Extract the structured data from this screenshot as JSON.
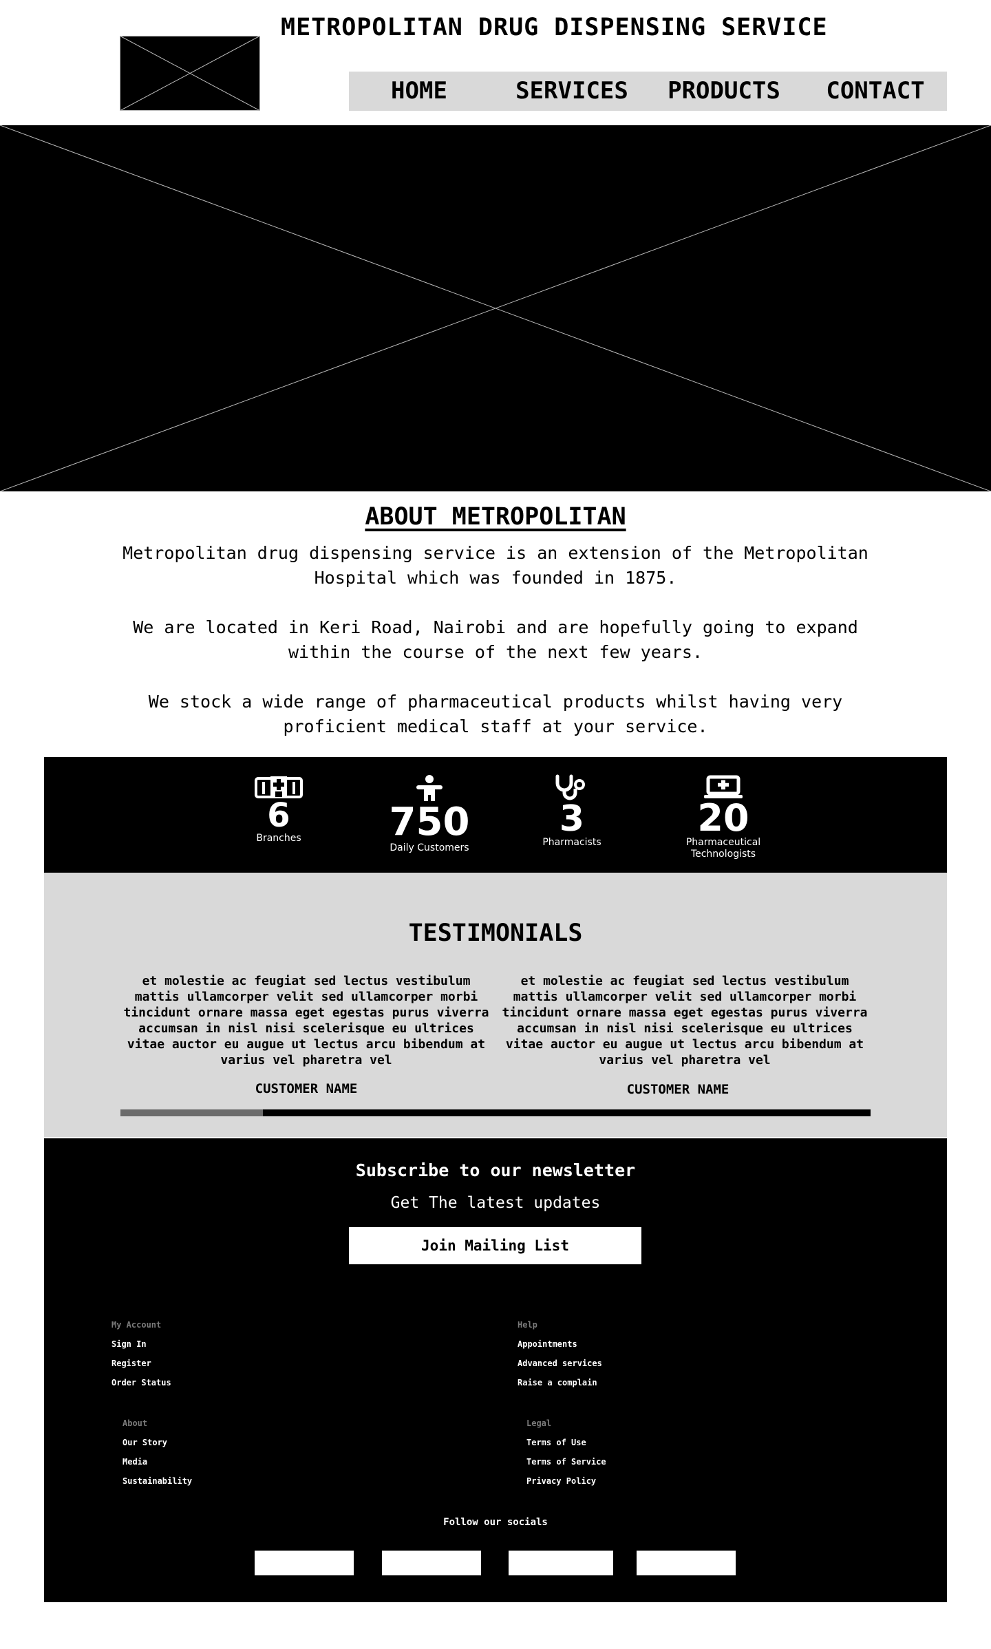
{
  "header": {
    "title": "METROPOLITAN DRUG DISPENSING SERVICE",
    "nav": [
      "HOME",
      "SERVICES",
      "PRODUCTS",
      "CONTACT"
    ]
  },
  "about": {
    "title": "ABOUT METROPOLITAN",
    "paragraphs": [
      "Metropolitan drug dispensing service is an extension of the Metropolitan Hospital which was founded in 1875.",
      "We are located in Keri Road, Nairobi and are hopefully going to expand within the course of the next few years.",
      "We stock a wide range of pharmaceutical products whilst having very proficient medical staff at your service."
    ]
  },
  "stats": [
    {
      "icon": "hospital-icon",
      "value": "6",
      "label": "Branches"
    },
    {
      "icon": "person-icon",
      "value": "750",
      "label": "Daily Customers"
    },
    {
      "icon": "stethoscope-icon",
      "value": "3",
      "label": "Pharmacists"
    },
    {
      "icon": "medical-laptop-icon",
      "value": "20",
      "label": "Pharmaceutical Technologists"
    }
  ],
  "testimonials": {
    "title": "TESTIMONIALS",
    "items": [
      {
        "quote": "et molestie ac feugiat sed lectus vestibulum mattis ullamcorper velit sed ullamcorper morbi tincidunt ornare massa eget egestas purus viverra accumsan in nisl nisi scelerisque eu ultrices vitae auctor eu augue ut lectus arcu bibendum at varius vel pharetra vel",
        "name": "CUSTOMER NAME"
      },
      {
        "quote": "et molestie ac feugiat sed lectus vestibulum mattis ullamcorper velit sed ullamcorper morbi tincidunt ornare massa eget egestas purus viverra accumsan in nisl nisi scelerisque eu ultrices vitae auctor eu augue ut lectus arcu bibendum at varius vel pharetra vel",
        "name": "CUSTOMER NAME"
      }
    ],
    "progress_fraction": 0.19
  },
  "newsletter": {
    "title": "Subscribe to our newsletter",
    "subtitle": "Get The latest updates",
    "button": "Join Mailing List"
  },
  "footer": {
    "columns": [
      {
        "heading": "My Account",
        "links": [
          "Sign In",
          "Register",
          "Order Status"
        ]
      },
      {
        "heading": "Help",
        "links": [
          "Appointments",
          "Advanced services",
          "Raise a complain"
        ]
      },
      {
        "heading": "About",
        "links": [
          "Our Story",
          "Media",
          "Sustainability"
        ]
      },
      {
        "heading": "Legal",
        "links": [
          "Terms of Use",
          "Terms of Service",
          "Privacy Policy"
        ]
      }
    ],
    "follow": "Follow our socials"
  },
  "colors": {
    "black": "#000000",
    "nav_bg": "#d9d9d9",
    "muted": "#7a7a7a",
    "slider_fill": "#6b6b6b"
  }
}
